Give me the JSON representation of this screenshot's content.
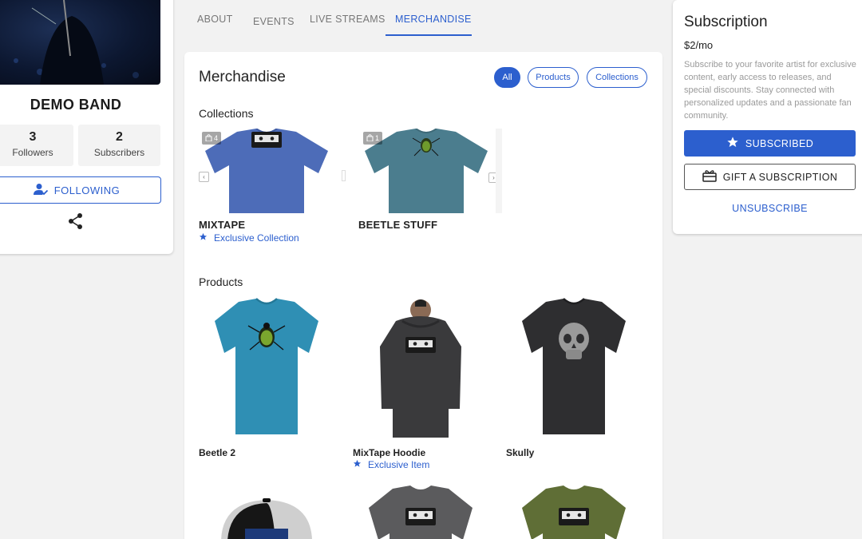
{
  "profile": {
    "band_name": "DEMO BAND",
    "followers_count": "3",
    "followers_label": "Followers",
    "subscribers_count": "2",
    "subscribers_label": "Subscribers",
    "follow_button": "FOLLOWING"
  },
  "tabs": [
    "ABOUT",
    "EVENTS",
    "LIVE STREAMS",
    "MERCHANDISE"
  ],
  "active_tab": "MERCHANDISE",
  "merch": {
    "title": "Merchandise",
    "filters": [
      "All",
      "Products",
      "Collections"
    ],
    "active_filter": "All",
    "collections_title": "Collections",
    "collections": [
      {
        "name": "MIXTAPE",
        "count": "4",
        "exclusive_label": "Exclusive Collection"
      },
      {
        "name": "BEETLE STUFF",
        "count": "1"
      }
    ],
    "products_title": "Products",
    "products": [
      {
        "name": "Beetle 2"
      },
      {
        "name": "MixTape Hoodie",
        "exclusive_label": "Exclusive Item"
      },
      {
        "name": "Skully"
      }
    ]
  },
  "subscription": {
    "title": "Subscription",
    "price": "$2/mo",
    "description": "Subscribe to your favorite artist for exclusive content, early access to releases, and special discounts. Stay connected with personalized updates and a passionate fan community.",
    "subscribed_button": "SUBSCRIBED",
    "gift_button": "GIFT A SUBSCRIPTION",
    "unsubscribe_link": "UNSUBSCRIBE"
  },
  "colors": {
    "accent": "#2c5fce",
    "page_bg": "#f2f2f2"
  }
}
